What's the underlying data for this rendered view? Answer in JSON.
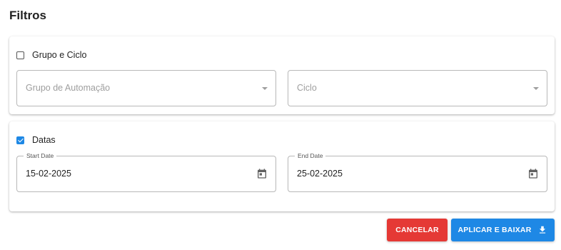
{
  "page": {
    "title": "Filtros"
  },
  "group_card": {
    "checkbox_label": "Grupo e Ciclo",
    "checked": false,
    "automation_group": {
      "placeholder": "Grupo de Automação",
      "icon": "dropdown-caret-icon"
    },
    "cycle": {
      "placeholder": "Ciclo",
      "icon": "dropdown-caret-icon"
    }
  },
  "dates_card": {
    "checkbox_label": "Datas",
    "checked": true,
    "start_date": {
      "label": "Start Date",
      "value": "15-02-2025",
      "icon": "calendar-icon"
    },
    "end_date": {
      "label": "End Date",
      "value": "25-02-2025",
      "icon": "calendar-icon"
    }
  },
  "actions": {
    "cancel_label": "CANCELAR",
    "apply_label": "APLICAR E BAIXAR",
    "apply_icon": "download-icon"
  },
  "colors": {
    "primary": "#1e88e5",
    "danger": "#e53935",
    "border": "#b8b8b8"
  }
}
